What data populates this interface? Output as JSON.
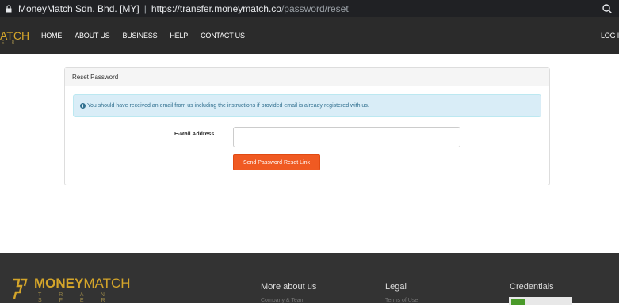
{
  "browser": {
    "site_name": "MoneyMatch Sdn. Bhd. [MY]",
    "separator": "|",
    "url_host": "https://transfer.moneymatch.co",
    "url_path": "/password/reset"
  },
  "nav": {
    "brand_fragment": "ATCH",
    "brand_sub": "E R",
    "links": [
      "HOME",
      "ABOUT US",
      "BUSINESS",
      "HELP",
      "CONTACT US"
    ],
    "login": "LOG I"
  },
  "card": {
    "title": "Reset Password",
    "alert_text": "You should have received an email from us including the instructions if provided email is already registered with us.",
    "email_label": "E-Mail Address",
    "email_value": "",
    "submit_label": "Send Password Reset Link"
  },
  "footer": {
    "brand_bold": "MONEY",
    "brand_light": "MATCH",
    "tagline": "T R A N S F E R",
    "col1_heading": "More about us",
    "col1_item": "Company & Team",
    "col2_heading": "Legal",
    "col2_item": "Terms of Use",
    "col3_heading": "Credentials"
  },
  "colors": {
    "accent": "#f05a22",
    "brand_gold": "#d4a52a",
    "alert_bg": "#d9edf7",
    "alert_text": "#31708f"
  }
}
